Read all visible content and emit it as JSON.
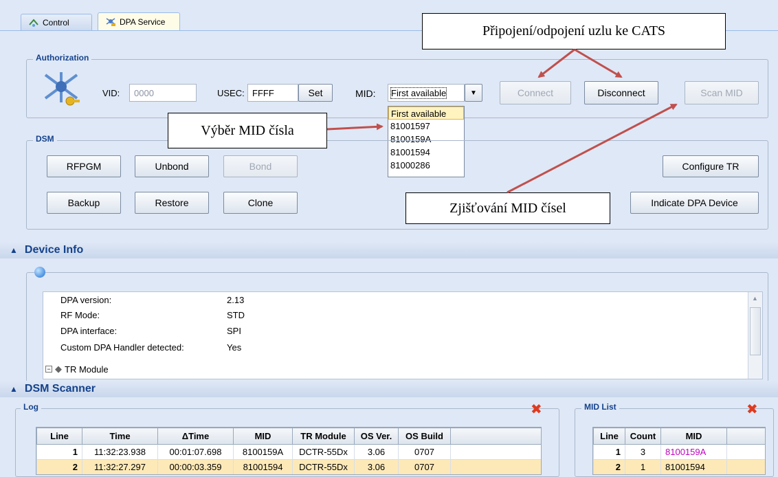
{
  "tabs": [
    {
      "label": "Control",
      "icon": "control-icon"
    },
    {
      "label": "DPA Service",
      "icon": "dpa-service-icon"
    }
  ],
  "authorization": {
    "title": "Authorization",
    "vid_label": "VID:",
    "vid_value": "0000",
    "usec_label": "USEC:",
    "usec_value": "FFFF",
    "set_label": "Set",
    "mid_label": "MID:",
    "mid_value": "First available",
    "mid_options": [
      "First available",
      "81001597",
      "8100159A",
      "81001594",
      "81000286"
    ],
    "connect_label": "Connect",
    "disconnect_label": "Disconnect",
    "scan_label": "Scan MID"
  },
  "dsm": {
    "title": "DSM",
    "rfpgm": "RFPGM",
    "unbond": "Unbond",
    "bond": "Bond",
    "backup": "Backup",
    "restore": "Restore",
    "clone": "Clone",
    "configure_tr": "Configure TR",
    "indicate": "Indicate DPA Device"
  },
  "callouts": {
    "connect": "Připojení/odpojení uzlu ke CATS",
    "mid_select": "Výběr MID čísla",
    "scan": "Zjišťování MID čísel"
  },
  "device_info": {
    "title": "Device Info",
    "rows": [
      {
        "key": "DPA version:",
        "value": "2.13"
      },
      {
        "key": "RF Mode:",
        "value": "STD"
      },
      {
        "key": "DPA interface:",
        "value": "SPI"
      },
      {
        "key": "Custom DPA Handler detected:",
        "value": "Yes"
      }
    ],
    "tree_node": "TR Module"
  },
  "scanner": {
    "title": "DSM Scanner",
    "log_title": "Log",
    "mid_list_title": "MID List",
    "log_headers": [
      "Line",
      "Time",
      "ΔTime",
      "MID",
      "TR Module",
      "OS Ver.",
      "OS Build"
    ],
    "log_rows": [
      [
        "1",
        "11:32:23.938",
        "00:01:07.698",
        "8100159A",
        "DCTR-55Dx",
        "3.06",
        "0707"
      ],
      [
        "2",
        "11:32:27.297",
        "00:00:03.359",
        "81001594",
        "DCTR-55Dx",
        "3.06",
        "0707"
      ]
    ],
    "mid_headers": [
      "Line",
      "Count",
      "MID"
    ],
    "mid_rows": [
      [
        "1",
        "3",
        "8100159A"
      ],
      [
        "2",
        "1",
        "81001594"
      ]
    ]
  },
  "colors": {
    "background": "#dfe8f6",
    "arrow": "#c0504d",
    "mid_highlight": "#c000c0"
  }
}
